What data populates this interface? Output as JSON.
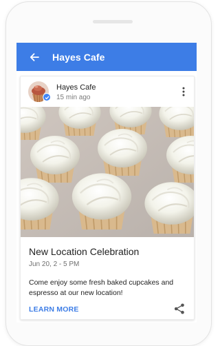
{
  "colors": {
    "app_bar": "#3d7de6",
    "link_blue": "#3d7de6",
    "verified_badge": "#4285f4",
    "frosting": "#f7f6ef",
    "cupcake_liner": "#d9b98d"
  },
  "app_bar": {
    "back_icon": "arrow-left-icon",
    "title": "Hayes Cafe"
  },
  "post": {
    "author": "Hayes Cafe",
    "time_ago": "15 min ago",
    "avatar_icon": "cupcake-avatar",
    "badge_icon": "verified-check-icon",
    "more_icon": "more-vert-icon",
    "photo": "cupcakes-photo",
    "event_title": "New Location Celebration",
    "event_date": "Jun 20, 2 - 5 PM",
    "body": "Come enjoy some fresh baked cupcakes and espresso at our new location!",
    "cta_label": "LEARN MORE",
    "share_icon": "share-icon"
  }
}
